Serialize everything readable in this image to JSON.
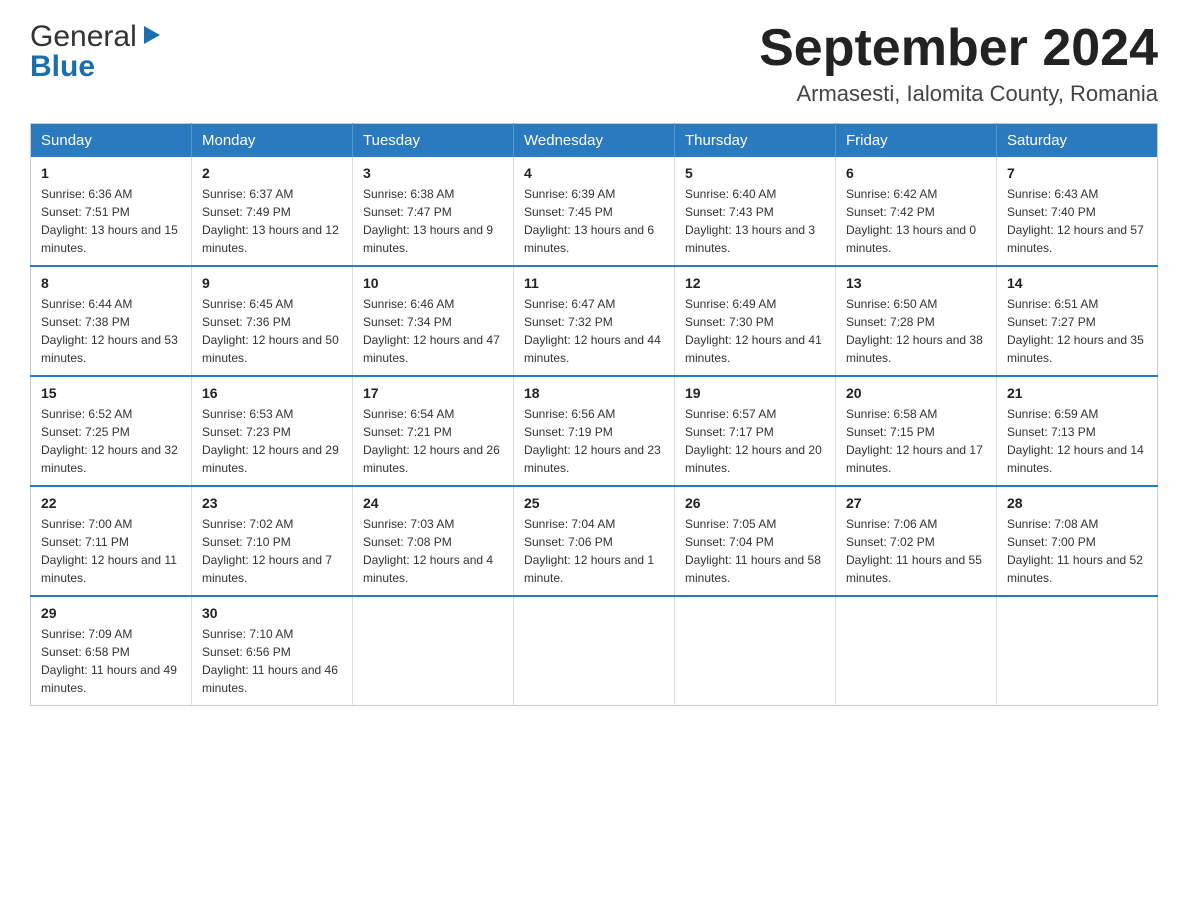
{
  "header": {
    "logo_general": "General",
    "logo_blue": "Blue",
    "month_title": "September 2024",
    "location": "Armasesti, Ialomita County, Romania"
  },
  "days_of_week": [
    "Sunday",
    "Monday",
    "Tuesday",
    "Wednesday",
    "Thursday",
    "Friday",
    "Saturday"
  ],
  "weeks": [
    [
      {
        "day": "1",
        "sunrise": "6:36 AM",
        "sunset": "7:51 PM",
        "daylight": "13 hours and 15 minutes."
      },
      {
        "day": "2",
        "sunrise": "6:37 AM",
        "sunset": "7:49 PM",
        "daylight": "13 hours and 12 minutes."
      },
      {
        "day": "3",
        "sunrise": "6:38 AM",
        "sunset": "7:47 PM",
        "daylight": "13 hours and 9 minutes."
      },
      {
        "day": "4",
        "sunrise": "6:39 AM",
        "sunset": "7:45 PM",
        "daylight": "13 hours and 6 minutes."
      },
      {
        "day": "5",
        "sunrise": "6:40 AM",
        "sunset": "7:43 PM",
        "daylight": "13 hours and 3 minutes."
      },
      {
        "day": "6",
        "sunrise": "6:42 AM",
        "sunset": "7:42 PM",
        "daylight": "13 hours and 0 minutes."
      },
      {
        "day": "7",
        "sunrise": "6:43 AM",
        "sunset": "7:40 PM",
        "daylight": "12 hours and 57 minutes."
      }
    ],
    [
      {
        "day": "8",
        "sunrise": "6:44 AM",
        "sunset": "7:38 PM",
        "daylight": "12 hours and 53 minutes."
      },
      {
        "day": "9",
        "sunrise": "6:45 AM",
        "sunset": "7:36 PM",
        "daylight": "12 hours and 50 minutes."
      },
      {
        "day": "10",
        "sunrise": "6:46 AM",
        "sunset": "7:34 PM",
        "daylight": "12 hours and 47 minutes."
      },
      {
        "day": "11",
        "sunrise": "6:47 AM",
        "sunset": "7:32 PM",
        "daylight": "12 hours and 44 minutes."
      },
      {
        "day": "12",
        "sunrise": "6:49 AM",
        "sunset": "7:30 PM",
        "daylight": "12 hours and 41 minutes."
      },
      {
        "day": "13",
        "sunrise": "6:50 AM",
        "sunset": "7:28 PM",
        "daylight": "12 hours and 38 minutes."
      },
      {
        "day": "14",
        "sunrise": "6:51 AM",
        "sunset": "7:27 PM",
        "daylight": "12 hours and 35 minutes."
      }
    ],
    [
      {
        "day": "15",
        "sunrise": "6:52 AM",
        "sunset": "7:25 PM",
        "daylight": "12 hours and 32 minutes."
      },
      {
        "day": "16",
        "sunrise": "6:53 AM",
        "sunset": "7:23 PM",
        "daylight": "12 hours and 29 minutes."
      },
      {
        "day": "17",
        "sunrise": "6:54 AM",
        "sunset": "7:21 PM",
        "daylight": "12 hours and 26 minutes."
      },
      {
        "day": "18",
        "sunrise": "6:56 AM",
        "sunset": "7:19 PM",
        "daylight": "12 hours and 23 minutes."
      },
      {
        "day": "19",
        "sunrise": "6:57 AM",
        "sunset": "7:17 PM",
        "daylight": "12 hours and 20 minutes."
      },
      {
        "day": "20",
        "sunrise": "6:58 AM",
        "sunset": "7:15 PM",
        "daylight": "12 hours and 17 minutes."
      },
      {
        "day": "21",
        "sunrise": "6:59 AM",
        "sunset": "7:13 PM",
        "daylight": "12 hours and 14 minutes."
      }
    ],
    [
      {
        "day": "22",
        "sunrise": "7:00 AM",
        "sunset": "7:11 PM",
        "daylight": "12 hours and 11 minutes."
      },
      {
        "day": "23",
        "sunrise": "7:02 AM",
        "sunset": "7:10 PM",
        "daylight": "12 hours and 7 minutes."
      },
      {
        "day": "24",
        "sunrise": "7:03 AM",
        "sunset": "7:08 PM",
        "daylight": "12 hours and 4 minutes."
      },
      {
        "day": "25",
        "sunrise": "7:04 AM",
        "sunset": "7:06 PM",
        "daylight": "12 hours and 1 minute."
      },
      {
        "day": "26",
        "sunrise": "7:05 AM",
        "sunset": "7:04 PM",
        "daylight": "11 hours and 58 minutes."
      },
      {
        "day": "27",
        "sunrise": "7:06 AM",
        "sunset": "7:02 PM",
        "daylight": "11 hours and 55 minutes."
      },
      {
        "day": "28",
        "sunrise": "7:08 AM",
        "sunset": "7:00 PM",
        "daylight": "11 hours and 52 minutes."
      }
    ],
    [
      {
        "day": "29",
        "sunrise": "7:09 AM",
        "sunset": "6:58 PM",
        "daylight": "11 hours and 49 minutes."
      },
      {
        "day": "30",
        "sunrise": "7:10 AM",
        "sunset": "6:56 PM",
        "daylight": "11 hours and 46 minutes."
      },
      null,
      null,
      null,
      null,
      null
    ]
  ],
  "labels": {
    "sunrise": "Sunrise: ",
    "sunset": "Sunset: ",
    "daylight": "Daylight: "
  }
}
